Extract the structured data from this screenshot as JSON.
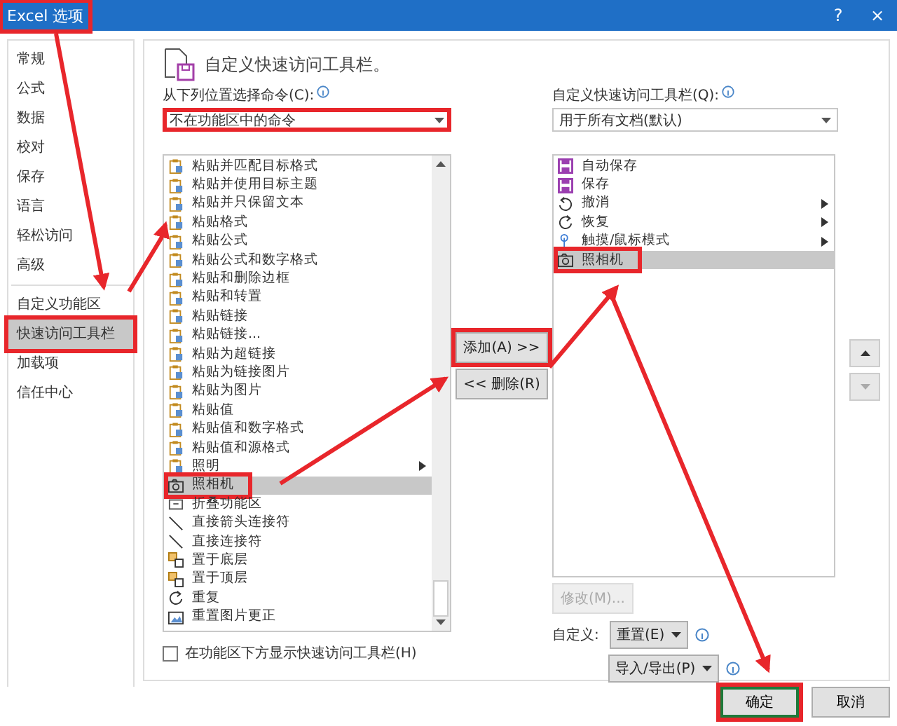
{
  "window": {
    "title": "Excel 选项",
    "title_annotated": true,
    "help": "?",
    "close": "×"
  },
  "sidebar": {
    "sections": [
      {
        "items": [
          {
            "label": "常规",
            "selected": false,
            "annotated": false
          },
          {
            "label": "公式",
            "selected": false,
            "annotated": false
          },
          {
            "label": "数据",
            "selected": false,
            "annotated": false
          },
          {
            "label": "校对",
            "selected": false,
            "annotated": false
          },
          {
            "label": "保存",
            "selected": false,
            "annotated": false
          },
          {
            "label": "语言",
            "selected": false,
            "annotated": false
          },
          {
            "label": "轻松访问",
            "selected": false,
            "annotated": false
          },
          {
            "label": "高级",
            "selected": false,
            "annotated": false
          }
        ]
      },
      {
        "items": [
          {
            "label": "自定义功能区",
            "selected": false,
            "annotated": false
          },
          {
            "label": "快速访问工具栏",
            "selected": true,
            "annotated": true
          },
          {
            "label": "加载项",
            "selected": false,
            "annotated": false
          },
          {
            "label": "信任中心",
            "selected": false,
            "annotated": false
          }
        ]
      }
    ]
  },
  "heading": "自定义快速访问工具栏。",
  "commands": {
    "label": "从下列位置选择命令(C):",
    "dropdown": {
      "value": "不在功能区中的命令",
      "annotated": true
    },
    "items": [
      {
        "label": "粘贴并匹配目标格式",
        "kind": "clipboard",
        "selected": false,
        "annotated": false,
        "submenu": false
      },
      {
        "label": "粘贴并使用目标主题",
        "kind": "clipboard",
        "selected": false,
        "annotated": false,
        "submenu": false
      },
      {
        "label": "粘贴并只保留文本",
        "kind": "clipboard",
        "selected": false,
        "annotated": false,
        "submenu": false
      },
      {
        "label": "粘贴格式",
        "kind": "clipboard",
        "selected": false,
        "annotated": false,
        "submenu": false
      },
      {
        "label": "粘贴公式",
        "kind": "clipboard",
        "selected": false,
        "annotated": false,
        "submenu": false
      },
      {
        "label": "粘贴公式和数字格式",
        "kind": "clipboard",
        "selected": false,
        "annotated": false,
        "submenu": false
      },
      {
        "label": "粘贴和删除边框",
        "kind": "clipboard",
        "selected": false,
        "annotated": false,
        "submenu": false
      },
      {
        "label": "粘贴和转置",
        "kind": "clipboard",
        "selected": false,
        "annotated": false,
        "submenu": false
      },
      {
        "label": "粘贴链接",
        "kind": "clipboard",
        "selected": false,
        "annotated": false,
        "submenu": false
      },
      {
        "label": "粘贴链接...",
        "kind": "clipboard",
        "selected": false,
        "annotated": false,
        "submenu": false
      },
      {
        "label": "粘贴为超链接",
        "kind": "clipboard",
        "selected": false,
        "annotated": false,
        "submenu": false
      },
      {
        "label": "粘贴为链接图片",
        "kind": "clipboard",
        "selected": false,
        "annotated": false,
        "submenu": false
      },
      {
        "label": "粘贴为图片",
        "kind": "clipboard",
        "selected": false,
        "annotated": false,
        "submenu": false
      },
      {
        "label": "粘贴值",
        "kind": "clipboard",
        "selected": false,
        "annotated": false,
        "submenu": false
      },
      {
        "label": "粘贴值和数字格式",
        "kind": "clipboard",
        "selected": false,
        "annotated": false,
        "submenu": false
      },
      {
        "label": "粘贴值和源格式",
        "kind": "clipboard",
        "selected": false,
        "annotated": false,
        "submenu": false
      },
      {
        "label": "照明",
        "kind": "clipboard",
        "selected": false,
        "annotated": false,
        "submenu": true
      },
      {
        "label": "照相机",
        "kind": "camera",
        "selected": true,
        "annotated": true,
        "submenu": false
      },
      {
        "label": "折叠功能区",
        "kind": "collapse",
        "selected": false,
        "annotated": false,
        "submenu": false
      },
      {
        "label": "直接箭头连接符",
        "kind": "line",
        "selected": false,
        "annotated": false,
        "submenu": false
      },
      {
        "label": "直接连接符",
        "kind": "line",
        "selected": false,
        "annotated": false,
        "submenu": false
      },
      {
        "label": "置于底层",
        "kind": "layers",
        "selected": false,
        "annotated": false,
        "submenu": false
      },
      {
        "label": "置于顶层",
        "kind": "layers",
        "selected": false,
        "annotated": false,
        "submenu": false
      },
      {
        "label": "重复",
        "kind": "redo",
        "selected": false,
        "annotated": false,
        "submenu": false
      },
      {
        "label": "重置图片更正",
        "kind": "picture",
        "selected": false,
        "annotated": false,
        "submenu": false
      }
    ],
    "checkbox": {
      "label": "在功能区下方显示快速访问工具栏(H)",
      "checked": false
    }
  },
  "middle": {
    "add": {
      "label": "添加(A) >>",
      "annotated": true
    },
    "remove": {
      "label": "<< 删除(R)",
      "annotated": false
    }
  },
  "toolbar": {
    "label": "自定义快速访问工具栏(Q):",
    "dropdown": {
      "value": "用于所有文档(默认)"
    },
    "items": [
      {
        "label": "自动保存",
        "kind": "save",
        "selected": false,
        "annotated": false,
        "submenu": false
      },
      {
        "label": "保存",
        "kind": "save",
        "selected": false,
        "annotated": false,
        "submenu": false
      },
      {
        "label": "撤消",
        "kind": "undo",
        "selected": false,
        "annotated": false,
        "submenu": true
      },
      {
        "label": "恢复",
        "kind": "redo",
        "selected": false,
        "annotated": false,
        "submenu": true
      },
      {
        "label": "触摸/鼠标模式",
        "kind": "touch",
        "selected": false,
        "annotated": false,
        "submenu": true
      },
      {
        "label": "照相机",
        "kind": "camera",
        "selected": true,
        "annotated": true,
        "submenu": false
      }
    ],
    "modify": {
      "label": "修改(M)...",
      "disabled": true
    },
    "customize_label": "自定义:",
    "reset": "重置(E)",
    "import_export": "导入/导出(P)"
  },
  "footer": {
    "ok": {
      "label": "确定",
      "annotated": true
    },
    "cancel": {
      "label": "取消",
      "annotated": false
    }
  }
}
